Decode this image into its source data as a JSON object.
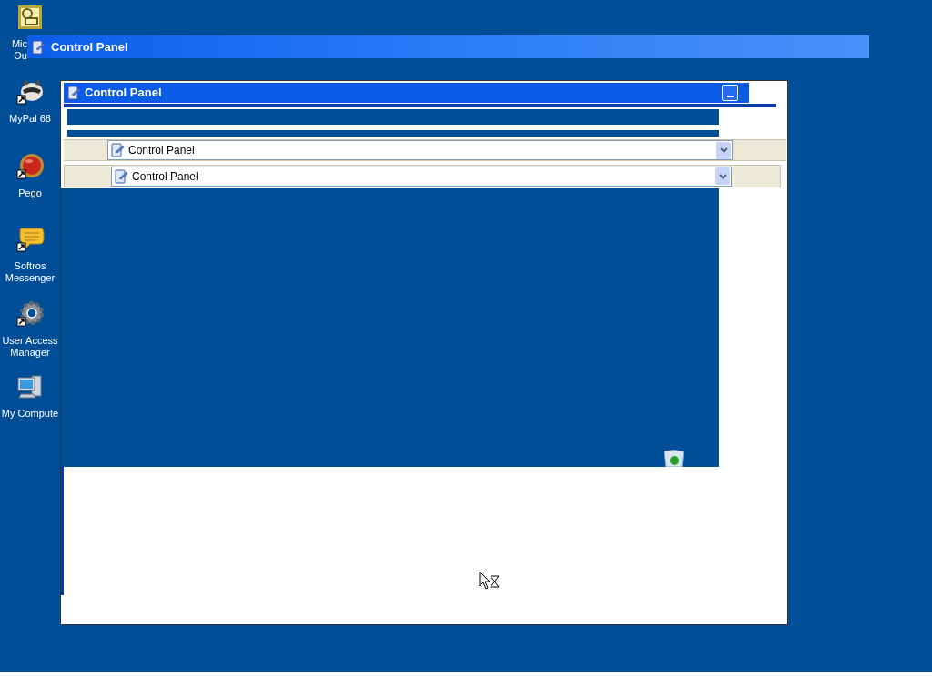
{
  "desktop_icons": [
    {
      "kind": "outlook",
      "lines": [
        "Mic",
        "Ou"
      ]
    },
    {
      "kind": "raccoon",
      "lines": [
        "MyPal 68"
      ]
    },
    {
      "kind": "ball",
      "lines": [
        "Pego"
      ]
    },
    {
      "kind": "bubble",
      "lines": [
        "Softros",
        "Messenger"
      ]
    },
    {
      "kind": "gear",
      "lines": [
        "User Access",
        "Manager"
      ]
    },
    {
      "kind": "computer",
      "lines": [
        "My Compute"
      ]
    }
  ],
  "floating_title_bar": {
    "title": "Control Panel"
  },
  "window": {
    "title": "Control Panel",
    "address_bars": [
      {
        "value": "Control Panel"
      },
      {
        "value": "Control Panel"
      }
    ]
  }
}
